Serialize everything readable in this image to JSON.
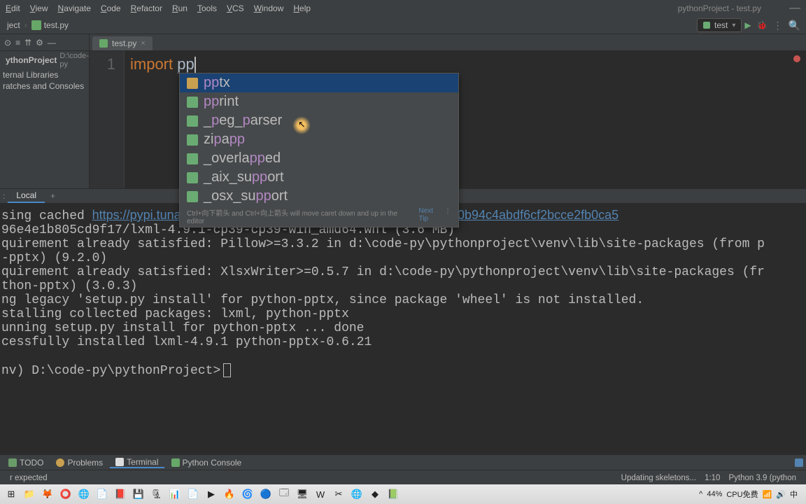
{
  "menu": {
    "items": [
      "Edit",
      "View",
      "Navigate",
      "Code",
      "Refactor",
      "Run",
      "Tools",
      "VCS",
      "Window",
      "Help"
    ],
    "breadcrumb": "pythonProject - test.py"
  },
  "nav": {
    "project": "ject",
    "file": "test.py",
    "run_config": "test"
  },
  "sidebar": {
    "tree": [
      {
        "label": "ythonProject",
        "path": "D:\\code-py"
      },
      {
        "label": "ternal Libraries"
      },
      {
        "label": "ratches and Consoles"
      }
    ]
  },
  "file_tab": {
    "name": "test.py"
  },
  "editor": {
    "line_num": "1",
    "keyword": "import",
    "typed_prefix": "pp"
  },
  "autocomplete": {
    "items": [
      {
        "pre": "pp",
        "rest": "tx",
        "kind": "folder",
        "sel": true
      },
      {
        "pre": "pp",
        "rest": "rint",
        "kind": "mod"
      },
      {
        "pre": "",
        "parts": [
          "_",
          "p",
          "eg_",
          "p",
          "arser"
        ],
        "kind": "mod",
        "hl": [
          1,
          3
        ]
      },
      {
        "pre": "",
        "parts": [
          "zi",
          "p",
          "a",
          "pp"
        ],
        "kind": "mod",
        "hl": [
          1,
          3
        ]
      },
      {
        "pre": "",
        "parts": [
          "_overla",
          "pp",
          "ed"
        ],
        "kind": "mod",
        "hl": [
          1
        ]
      },
      {
        "pre": "",
        "parts": [
          "_aix_su",
          "pp",
          "ort"
        ],
        "kind": "mod",
        "hl": [
          1
        ]
      },
      {
        "pre": "",
        "parts": [
          "_osx_su",
          "pp",
          "ort"
        ],
        "kind": "mod",
        "hl": [
          1
        ]
      }
    ],
    "hint_left": "Ctrl+向下箭头 and Ctrl+向上箭头 will move caret down and up in the editor",
    "hint_link": "Next Tip"
  },
  "terminal_tab": {
    "label": "Local"
  },
  "terminal": {
    "lines": [
      {
        "t": "sing cached "
      },
      {
        "link": "https://pypi.tuna.tsinghua.edu.cn/packages/1f/78/7cc7e269c7c58f0b94c4abdf6cf2bcce2fb0ca5"
      },
      {
        "t": "96e4e1b805cd9f17/lxml-4.9.1-cp39-cp39-win_amd64.whl (3.6 MB)"
      },
      {
        "t": "quirement already satisfied: Pillow>=3.3.2 in d:\\code-py\\pythonproject\\venv\\lib\\site-packages (from p"
      },
      {
        "t": "-pptx) (9.2.0)"
      },
      {
        "t": "quirement already satisfied: XlsxWriter>=0.5.7 in d:\\code-py\\pythonproject\\venv\\lib\\site-packages (fr"
      },
      {
        "t": "thon-pptx) (3.0.3)"
      },
      {
        "t": "ng legacy 'setup.py install' for python-pptx, since package 'wheel' is not installed."
      },
      {
        "t": "stalling collected packages: lxml, python-pptx"
      },
      {
        "t": "unning setup.py install for python-pptx ... done"
      },
      {
        "t": "cessfully installed lxml-4.9.1 python-pptx-0.6.21"
      },
      {
        "t": ""
      },
      {
        "t": "nv) D:\\code-py\\pythonProject>",
        "prompt": true
      }
    ]
  },
  "bottom_tabs": {
    "items": [
      "TODO",
      "Problems",
      "Terminal",
      "Python Console"
    ],
    "active": 2
  },
  "status": {
    "left": "r expected",
    "skel": "Updating skeletons...",
    "pos": "1:10",
    "py": "Python 3.9 (python"
  },
  "taskbar": {
    "apps": [
      "⊞",
      "📁",
      "🦊",
      "⭕",
      "🌐",
      "📄",
      "📕",
      "💾",
      "🗜",
      "📊",
      "📄",
      "▶",
      "🔥",
      "🌀",
      "🔵",
      "🗔",
      "🖥",
      "W",
      "✂",
      "🌐",
      "◆",
      "📗"
    ],
    "tray": {
      "up": "^",
      "battery": "44%",
      "cpu": "CPU免费",
      "wifi": "📶",
      "vol": "🔊",
      "ime": "中",
      "clk1": "",
      "clk2": ""
    }
  }
}
